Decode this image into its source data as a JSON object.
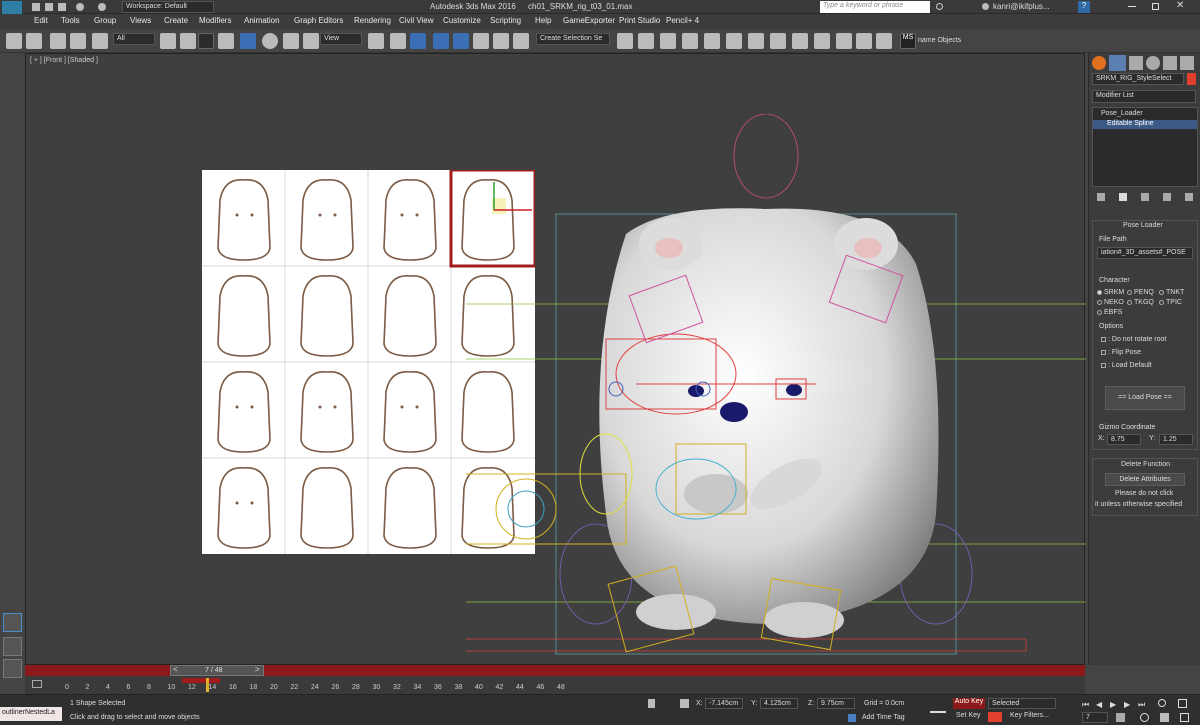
{
  "titlebar": {
    "workspace": "Workspace: Default",
    "app_title": "Autodesk 3ds Max 2016",
    "file_name": "ch01_SRKM_rig_t03_01.max",
    "search_placeholder": "Type a keyword or phrase",
    "user": "kanri@ikifplus...",
    "app_logo": "MAX"
  },
  "menu": [
    "Edit",
    "Tools",
    "Group",
    "Views",
    "Create",
    "Modifiers",
    "Animation",
    "Graph Editors",
    "Rendering",
    "Civil View",
    "Customize",
    "Scripting",
    "Help",
    "GameExporter",
    "Print Studio",
    "Pencil+ 4"
  ],
  "toolbar": {
    "filter": "All",
    "view": "View",
    "selection_set": "Create Selection Se",
    "name_objects": "name Objects"
  },
  "viewport": {
    "label": "[ + ] [Front ] [Shaded ]"
  },
  "right_panel": {
    "object_name": "SRKM_RIG_StyleSelect",
    "modifier_list": "Modifier List",
    "stack": [
      "Pose_Loader",
      "Editable Spline"
    ],
    "pose_loader": {
      "title": "Pose Loader",
      "file_path_label": "File Path",
      "file_path_value": "iation#_3D_assets#_POSE",
      "character_label": "Character",
      "characters": [
        "SRKM",
        "PENQ",
        "TNKT",
        "NEKO",
        "TKGQ",
        "TPIC",
        "EBFS"
      ],
      "options_label": "Options",
      "options": [
        ": Do not rotate root",
        ": Flip Pose",
        ": Load Default"
      ],
      "load_button": "== Load Pose ==",
      "gizmo_label": "Gizmo Coordinate",
      "gizmo_x_label": "X:",
      "gizmo_x": "8.75",
      "gizmo_y_label": "Y:",
      "gizmo_y": "1.25"
    },
    "delete_function": {
      "title": "Delete Function",
      "button": "Delete Attributes",
      "note1": "Please do not click",
      "note2": "it unless otherwise specified"
    }
  },
  "timeline": {
    "frame": "7 / 48",
    "ticks": [
      "0",
      "2",
      "4",
      "6",
      "8",
      "10",
      "12",
      "14",
      "16",
      "18",
      "20",
      "22",
      "24",
      "26",
      "28",
      "30",
      "32",
      "34",
      "36",
      "38",
      "40",
      "42",
      "44",
      "46",
      "48"
    ]
  },
  "status": {
    "outliner": "outlinerNestedLa",
    "selection": "1 Shape Selected",
    "prompt": "Click and drag to select and move objects",
    "x_label": "X:",
    "x": "-7.145cm",
    "y_label": "Y:",
    "y": "4.125cm",
    "z_label": "Z:",
    "z": "9.75cm",
    "grid": "Grid = 0.0cm",
    "add_time_tag": "Add Time Tag",
    "auto_key": "Auto Key",
    "selected": "Selected",
    "set_key": "Set Key",
    "key_filters": "Key Filters...",
    "frame_field": "7"
  },
  "colors": {
    "accent_red": "#8c1a1a",
    "viewport_bg": "#3f3f3f",
    "selection_red": "#c8342c"
  }
}
